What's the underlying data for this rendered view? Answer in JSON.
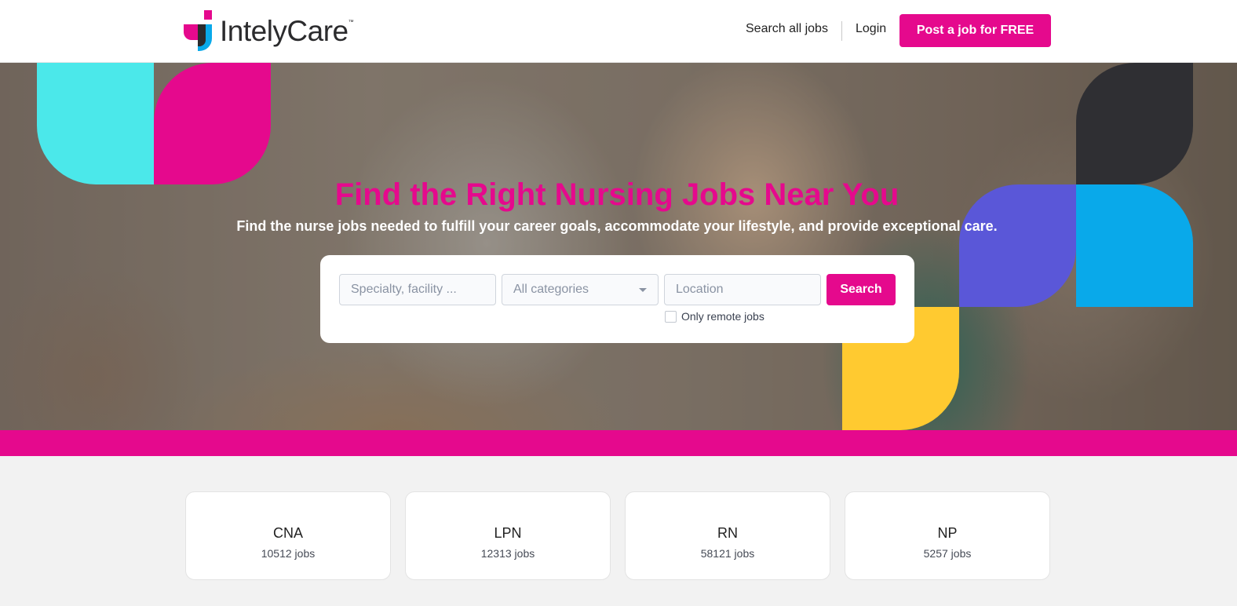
{
  "header": {
    "logo_text": "IntelyCare",
    "logo_tm": "™",
    "nav_search": "Search all jobs",
    "nav_login": "Login",
    "post_button": "Post a job for FREE"
  },
  "hero": {
    "title": "Find the Right Nursing Jobs Near You",
    "subtitle": "Find the nurse jobs needed to fulfill your career goals, accommodate your lifestyle, and provide exceptional care."
  },
  "search": {
    "specialty_placeholder": "Specialty, facility ...",
    "category_value": "All categories",
    "location_placeholder": "Location",
    "search_button": "Search",
    "remote_label": "Only remote jobs"
  },
  "categories": [
    {
      "title": "CNA",
      "count": "10512 jobs"
    },
    {
      "title": "LPN",
      "count": "12313 jobs"
    },
    {
      "title": "RN",
      "count": "58121 jobs"
    },
    {
      "title": "NP",
      "count": "5257 jobs"
    }
  ],
  "colors": {
    "brand_magenta": "#e5098d",
    "cyan": "#4be8ea",
    "purple": "#5a57d8",
    "blue": "#09a9ea",
    "yellow": "#ffca30",
    "dark": "#2f2f33"
  }
}
